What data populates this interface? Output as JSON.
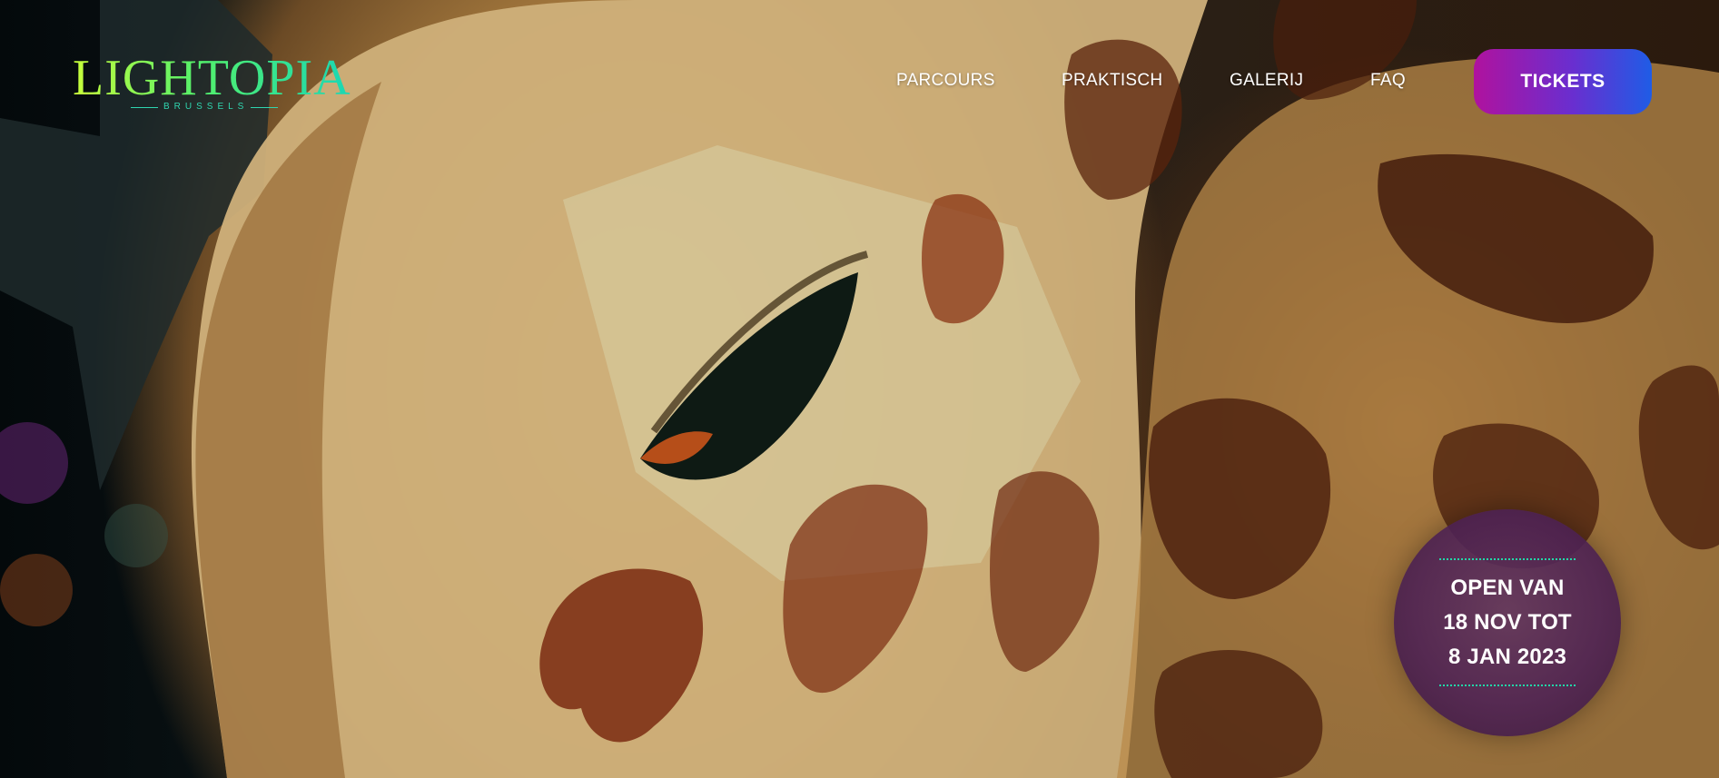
{
  "logo": {
    "wordmark": "LIGHTOPIA",
    "subtitle": "BRUSSELS"
  },
  "nav": {
    "items": [
      {
        "label": "PARCOURS"
      },
      {
        "label": "PRAKTISCH"
      },
      {
        "label": "GALERIJ"
      },
      {
        "label": "FAQ"
      }
    ]
  },
  "cta": {
    "tickets_label": "TICKETS"
  },
  "badge": {
    "line1": "OPEN VAN",
    "line2": "18 NOV TOT",
    "line3": "8 JAN 2023"
  },
  "colors": {
    "logo_gradient": [
      "#c8ff3a",
      "#19d7b5"
    ],
    "tickets_gradient": [
      "#b0129e",
      "#1f5ce6"
    ],
    "badge_dots": "#21d8a8"
  },
  "icons": {
    "hero": "giraffe-lantern-image"
  }
}
